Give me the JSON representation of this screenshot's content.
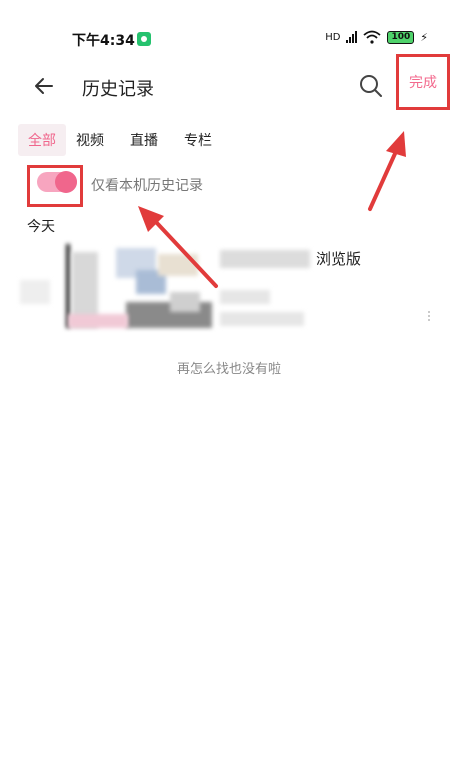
{
  "status_bar": {
    "time": "下午4:34",
    "network_label": "HD",
    "battery": "100"
  },
  "header": {
    "title": "历史记录",
    "done_label": "完成"
  },
  "tabs": [
    {
      "label": "全部",
      "active": true
    },
    {
      "label": "视频",
      "active": false
    },
    {
      "label": "直播",
      "active": false
    },
    {
      "label": "专栏",
      "active": false
    }
  ],
  "local_only_toggle": {
    "label": "仅看本机历史记录",
    "on": true
  },
  "sections": [
    {
      "heading": "今天",
      "items": [
        {
          "title_visible": "浏览版"
        }
      ]
    }
  ],
  "end_message": "再怎么找也没有啦",
  "colors": {
    "accent_pink": "#f0668c",
    "annotation_red": "#e13b3b"
  }
}
